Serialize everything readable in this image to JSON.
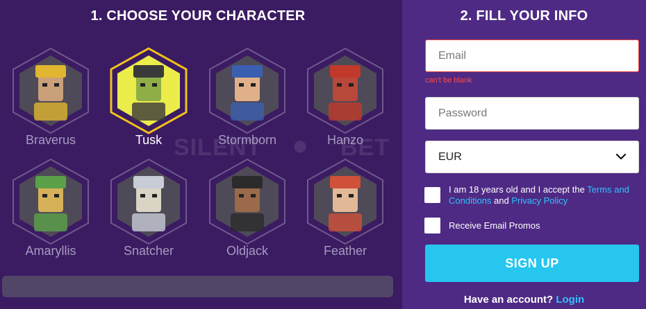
{
  "left": {
    "title": "1. CHOOSE YOUR CHARACTER",
    "characters": [
      {
        "name": "Braverus",
        "selected": false
      },
      {
        "name": "Tusk",
        "selected": true
      },
      {
        "name": "Stormborn",
        "selected": false
      },
      {
        "name": "Hanzo",
        "selected": false
      },
      {
        "name": "Amaryllis",
        "selected": false
      },
      {
        "name": "Snatcher",
        "selected": false
      },
      {
        "name": "Oldjack",
        "selected": false
      },
      {
        "name": "Feather",
        "selected": false
      }
    ],
    "watermark_left": "SILENT",
    "watermark_right": "BET"
  },
  "right": {
    "title": "2. FILL YOUR INFO",
    "email_placeholder": "Email",
    "email_error": "can't be blank",
    "password_placeholder": "Password",
    "currency": "EUR",
    "terms_prefix": "I am 18 years old and I accept the ",
    "terms_link": "Terms and Conditions",
    "terms_and": " and ",
    "privacy_link": "Privacy Policy",
    "promos_label": "Receive Email Promos",
    "signup_label": "SIGN UP",
    "have_account": "Have an account?",
    "login_link": "Login"
  },
  "colors": {
    "left_bg": "#3b1b62",
    "right_bg": "#4e2a84",
    "accent": "#26c6ef",
    "selected_border": "#f2c21b",
    "error": "#ff4b4b"
  }
}
